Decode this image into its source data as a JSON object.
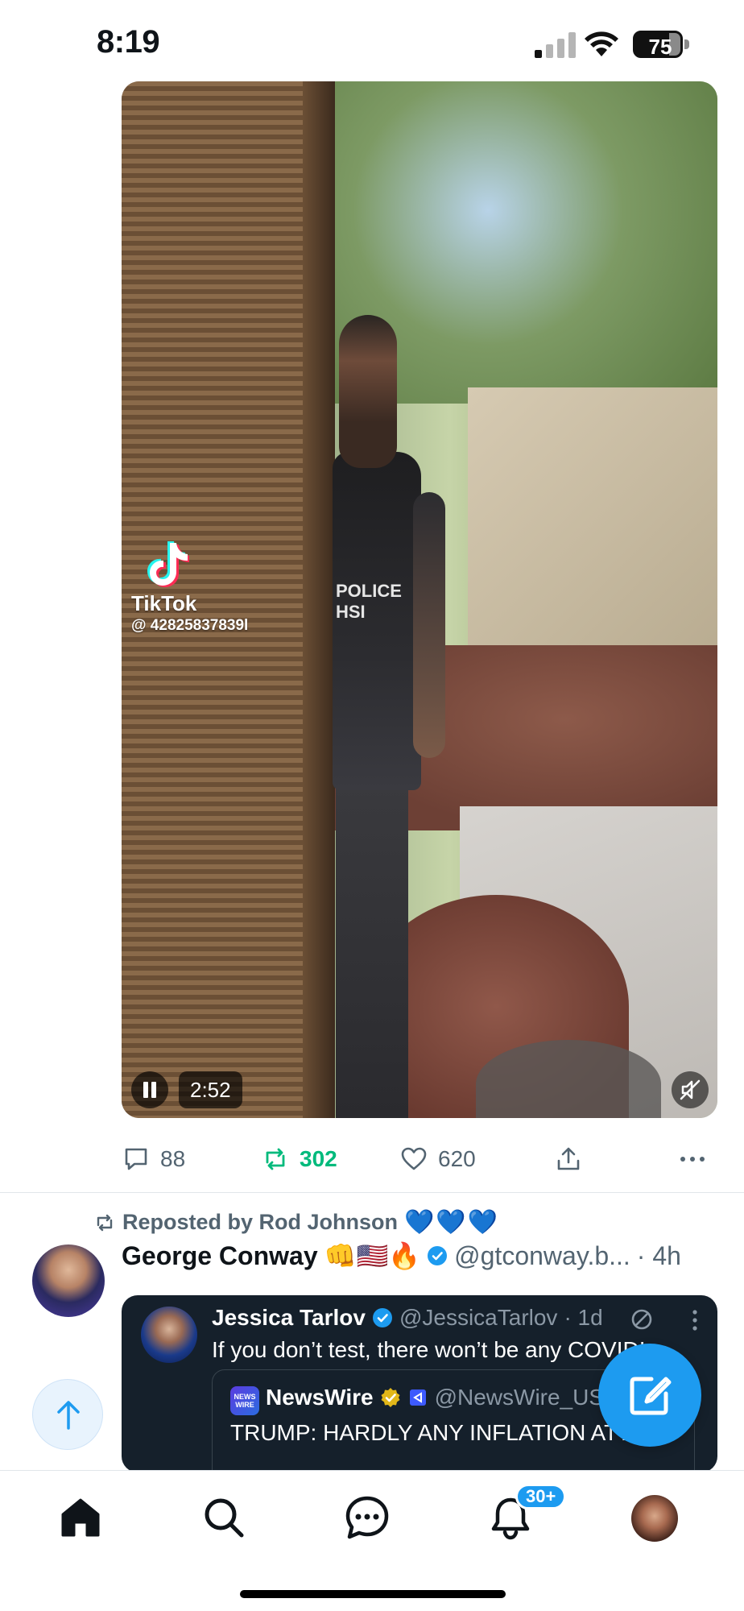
{
  "status_bar": {
    "time": "8:19",
    "battery": "75",
    "battery_level_percent": 75
  },
  "video": {
    "watermark_app": "TikTok",
    "watermark_handle": "@ 42825837839l",
    "duration": "2:52",
    "badge_text": "POLICE\nHSI",
    "controls": {
      "pause_icon": "pause-icon",
      "mute_icon": "muted-speaker-icon"
    }
  },
  "actions": {
    "reply_count": "88",
    "retweet_count": "302",
    "like_count": "620",
    "retweeted": true,
    "icons": [
      "reply-icon",
      "retweet-icon",
      "like-icon",
      "share-icon",
      "more-icon"
    ],
    "colors": {
      "muted": "#536471",
      "retweet_active": "#00ba7c"
    }
  },
  "next_tweet": {
    "repost_label": "Reposted by Rod Johnson",
    "repost_emojis": "💙💙💙",
    "author_name": "George Conway",
    "author_emojis": "👊🇺🇸🔥",
    "author_handle": "@gtconway.b...",
    "time": "· 4h",
    "quoted": {
      "author_name": "Jessica Tarlov",
      "author_handle": "@JessicaTarlov",
      "time": "· 1d",
      "text": "If you don’t test, there won’t be any COVID!",
      "inner_quote": {
        "logo_text": "NEWS WIRE",
        "author_name": "NewsWire",
        "author_handle": "@NewsWire_US",
        "text": "TRUMP: HARDLY ANY INFLATION AT ALL"
      }
    }
  },
  "floating": {
    "scroll_top_icon": "arrow-up-icon",
    "compose_icon": "compose-icon",
    "compose_color": "#1d9bf0"
  },
  "bottom_nav": {
    "items": [
      "home-icon",
      "search-icon",
      "grok-chat-icon",
      "notifications-icon",
      "profile-avatar"
    ],
    "notifications_badge": "30+"
  }
}
